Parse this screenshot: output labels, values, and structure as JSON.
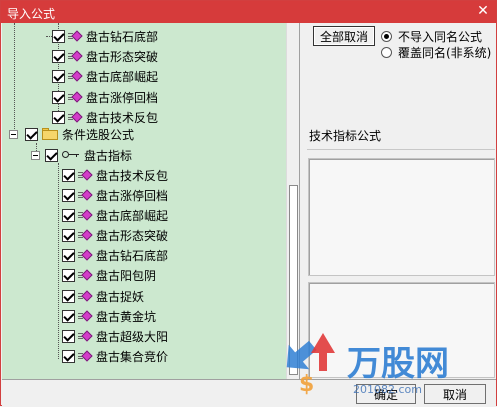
{
  "window": {
    "title": "导入公式",
    "close_glyph": "✕"
  },
  "tree": {
    "group1_items": [
      {
        "label": "盘古钻石底部"
      },
      {
        "label": "盘古形态突破"
      },
      {
        "label": "盘古底部崛起"
      },
      {
        "label": "盘古涨停回档"
      },
      {
        "label": "盘古技术反包"
      }
    ],
    "folder_label": "条件选股公式",
    "indicator_label": "盘古指标",
    "group2_items": [
      {
        "label": "盘古技术反包"
      },
      {
        "label": "盘古涨停回档"
      },
      {
        "label": "盘古底部崛起"
      },
      {
        "label": "盘古形态突破"
      },
      {
        "label": "盘古钻石底部"
      },
      {
        "label": "盘古阳包阴"
      },
      {
        "label": "盘古捉妖"
      },
      {
        "label": "盘古黄金坑"
      },
      {
        "label": "盘古超级大阳"
      },
      {
        "label": "盘古集合竞价"
      }
    ]
  },
  "options": {
    "cancel_all_label": "全部取消",
    "radio_no_import": "不导入同名公式",
    "radio_overwrite": "覆盖同名(非系统)",
    "selected": "不导入同名公式"
  },
  "tech_label": "技术指标公式",
  "footer": {
    "ok_label": "确定",
    "cancel_label": "取消"
  },
  "watermark": {
    "brand": "万股网",
    "url": "201082.com"
  },
  "colors": {
    "title_bar": "#d63b3b",
    "tree_bg": "#cce8cf",
    "formula_icon": "#d33cc9",
    "watermark_blue": "#2f7fd3"
  }
}
